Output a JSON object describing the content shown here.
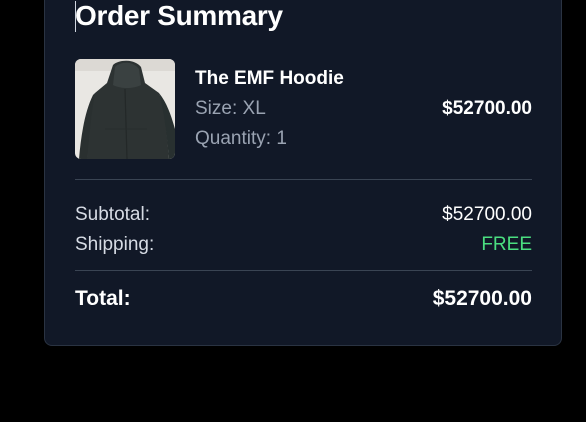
{
  "order_summary": {
    "title": "Order Summary",
    "item": {
      "image_icon": "hoodie-product-image",
      "name": "The EMF Hoodie",
      "size": "Size: XL",
      "quantity": "Quantity: 1",
      "price": "$52700.00"
    },
    "subtotal": {
      "label": "Subtotal:",
      "value": "$52700.00"
    },
    "shipping": {
      "label": "Shipping:",
      "value": "FREE"
    },
    "total": {
      "label": "Total:",
      "value": "$52700.00"
    }
  },
  "colors": {
    "page_background": "#000000",
    "card_background": "#111827",
    "free_shipping": "#4ade80",
    "muted_text": "#9aa3b2"
  }
}
